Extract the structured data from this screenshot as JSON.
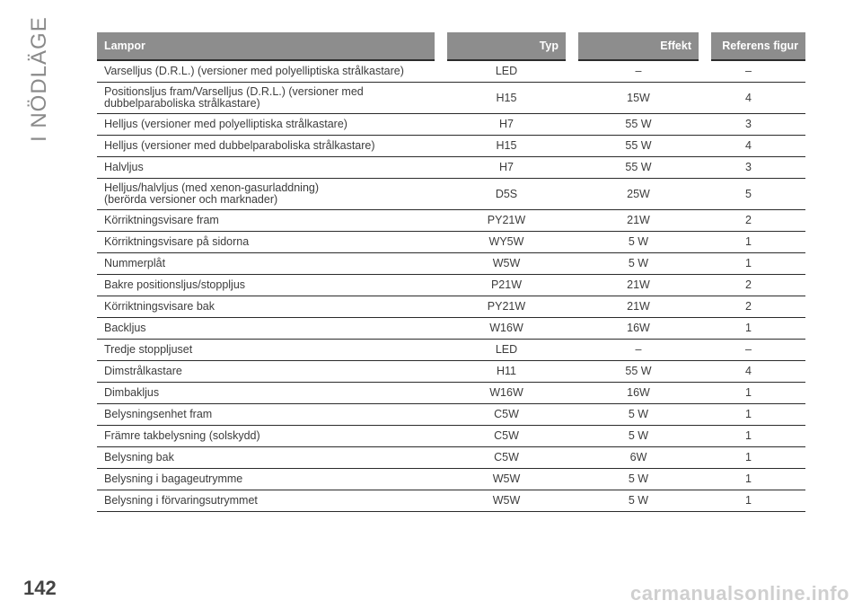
{
  "section_title": "I NÖDLÄGE",
  "page_number": "142",
  "watermark": "carmanualsonline.info",
  "table": {
    "headers": {
      "lamp": "Lampor",
      "type": "Typ",
      "power": "Effekt",
      "ref": "Referens figur"
    },
    "rows": [
      {
        "lamp": "Varselljus (D.R.L.) (versioner med polyelliptiska strålkastare)",
        "type": "LED",
        "power": "–",
        "ref": "–"
      },
      {
        "lamp": "Positionsljus fram/Varselljus (D.R.L.) (versioner med\ndubbelparaboliska strålkastare)",
        "type": "H15",
        "power": "15W",
        "ref": "4"
      },
      {
        "lamp": "Helljus (versioner med polyelliptiska strålkastare)",
        "type": "H7",
        "power": "55 W",
        "ref": "3"
      },
      {
        "lamp": "Helljus (versioner med dubbelparaboliska strålkastare)",
        "type": "H15",
        "power": "55 W",
        "ref": "4"
      },
      {
        "lamp": "Halvljus",
        "type": "H7",
        "power": "55 W",
        "ref": "3"
      },
      {
        "lamp": "Helljus/halvljus (med xenon-gasurladdning)\n(berörda versioner och marknader)",
        "type": "D5S",
        "power": "25W",
        "ref": "5"
      },
      {
        "lamp": "Körriktningsvisare fram",
        "type": "PY21W",
        "power": "21W",
        "ref": "2"
      },
      {
        "lamp": "Körriktningsvisare på sidorna",
        "type": "WY5W",
        "power": "5 W",
        "ref": "1"
      },
      {
        "lamp": "Nummerplåt",
        "type": "W5W",
        "power": "5 W",
        "ref": "1"
      },
      {
        "lamp": "Bakre positionsljus/stoppljus",
        "type": "P21W",
        "power": "21W",
        "ref": "2"
      },
      {
        "lamp": "Körriktningsvisare bak",
        "type": "PY21W",
        "power": "21W",
        "ref": "2"
      },
      {
        "lamp": "Backljus",
        "type": "W16W",
        "power": "16W",
        "ref": "1"
      },
      {
        "lamp": "Tredje stoppljuset",
        "type": "LED",
        "power": "–",
        "ref": "–"
      },
      {
        "lamp": "Dimstrålkastare",
        "type": "H11",
        "power": "55 W",
        "ref": "4"
      },
      {
        "lamp": "Dimbakljus",
        "type": "W16W",
        "power": "16W",
        "ref": "1"
      },
      {
        "lamp": "Belysningsenhet fram",
        "type": "C5W",
        "power": "5 W",
        "ref": "1"
      },
      {
        "lamp": "Främre takbelysning (solskydd)",
        "type": "C5W",
        "power": "5 W",
        "ref": "1"
      },
      {
        "lamp": "Belysning bak",
        "type": "C5W",
        "power": "6W",
        "ref": "1"
      },
      {
        "lamp": "Belysning i bagageutrymme",
        "type": "W5W",
        "power": "5 W",
        "ref": "1"
      },
      {
        "lamp": "Belysning i förvaringsutrymmet",
        "type": "W5W",
        "power": "5 W",
        "ref": "1"
      }
    ]
  }
}
